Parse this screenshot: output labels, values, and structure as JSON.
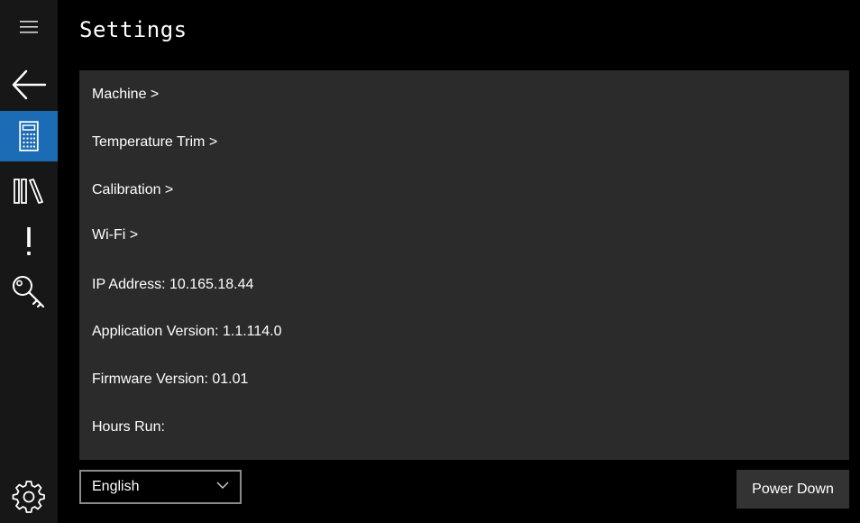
{
  "header": {
    "title": "Settings"
  },
  "nav": {
    "items": [
      {
        "name": "menu",
        "icon": "hamburger-icon"
      },
      {
        "name": "back",
        "icon": "back-arrow-icon"
      },
      {
        "name": "calculator",
        "icon": "calculator-icon",
        "selected": true
      },
      {
        "name": "library",
        "icon": "library-icon"
      },
      {
        "name": "alerts",
        "icon": "exclamation-icon"
      },
      {
        "name": "keys",
        "icon": "key-icon"
      },
      {
        "name": "settings",
        "icon": "gear-icon"
      }
    ],
    "selected_color": "#1b6bb5"
  },
  "settings": {
    "machine": "Machine >",
    "temperature_trim": "Temperature Trim >",
    "calibration": "Calibration >",
    "wifi": "Wi-Fi >",
    "ip_address": "IP Address: 10.165.18.44",
    "application_version": "Application Version: 1.1.114.0",
    "firmware_version": "Firmware Version: 01.01",
    "hours_run": "Hours Run:"
  },
  "footer": {
    "language_selected": "English",
    "power_down_label": "Power Down"
  }
}
